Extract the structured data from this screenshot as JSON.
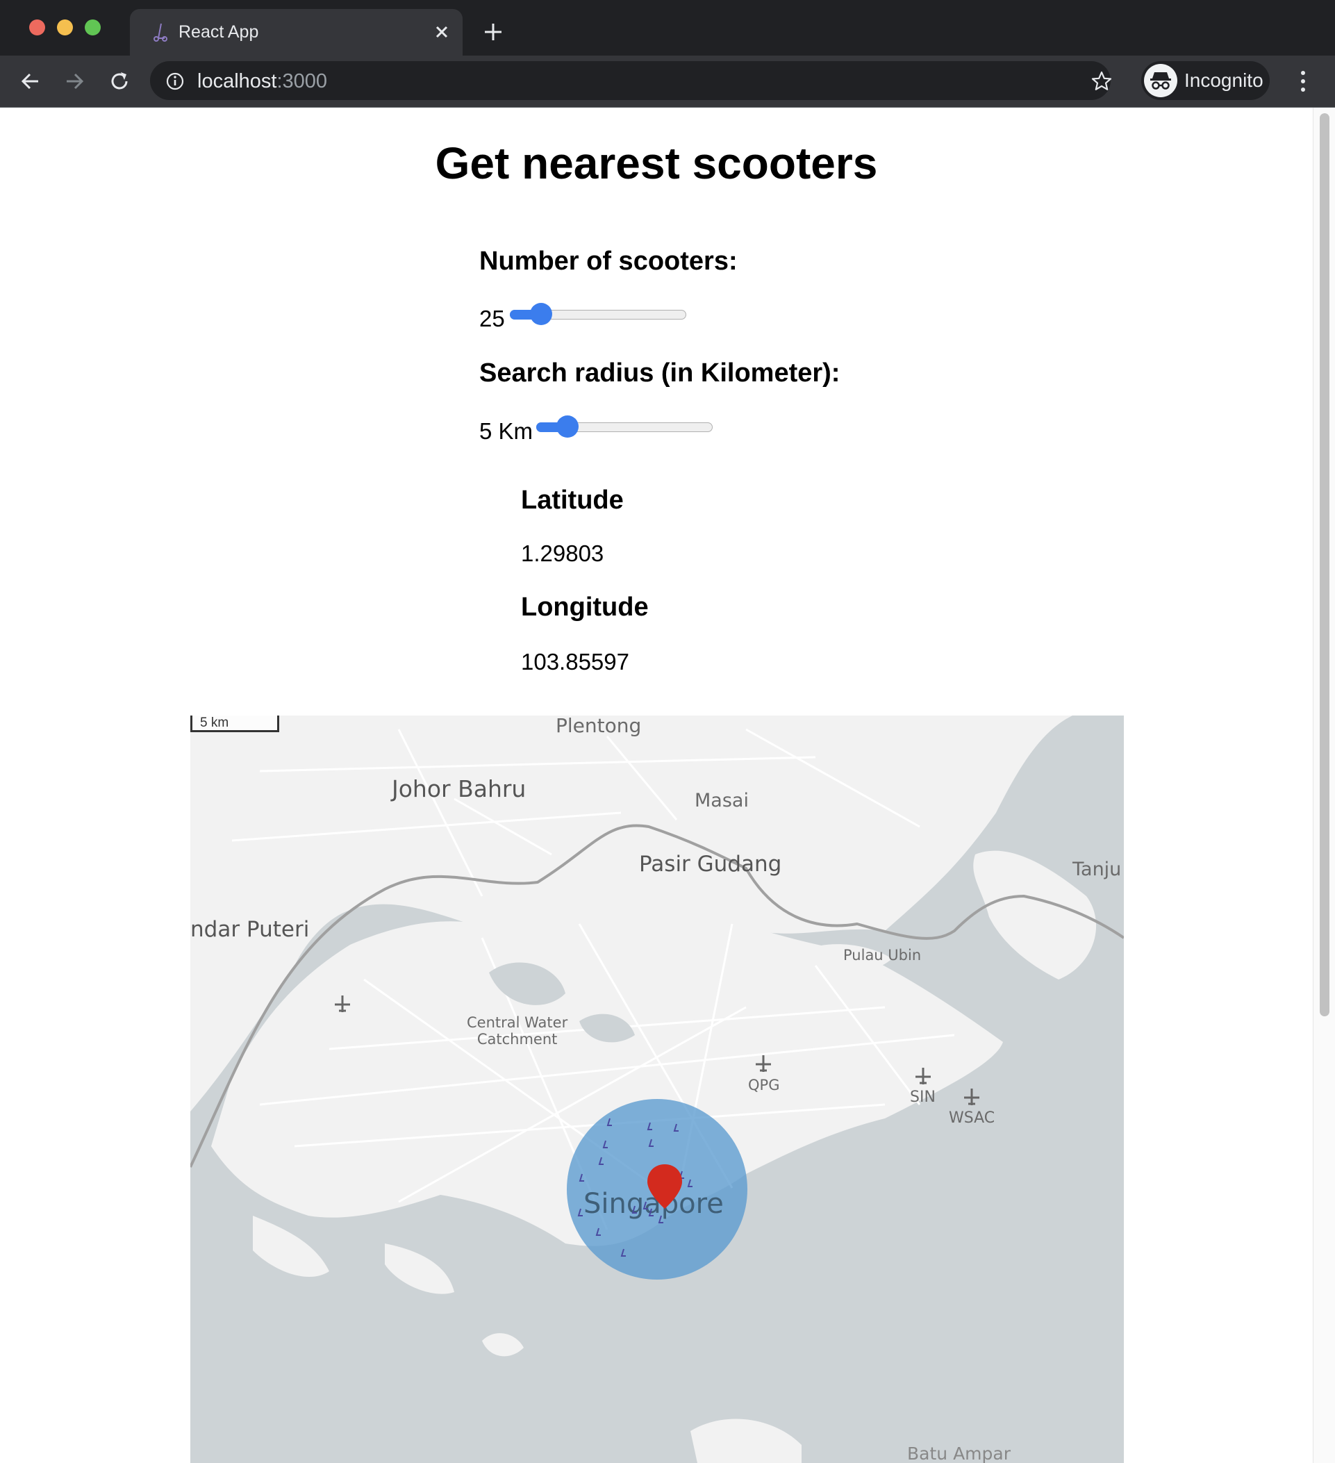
{
  "browser": {
    "tab_title": "React App",
    "url_host": "localhost",
    "url_port": ":3000",
    "profile_label": "Incognito"
  },
  "page": {
    "title": "Get nearest scooters",
    "scooter_count": {
      "label": "Number of scooters:",
      "value": "25",
      "slider_fraction": 0.13
    },
    "radius": {
      "label": "Search radius (in Kilometer):",
      "value": "5 Km",
      "slider_fraction": 0.13
    },
    "latitude": {
      "label": "Latitude",
      "value": "1.29803"
    },
    "longitude": {
      "label": "Longitude",
      "value": "103.85597"
    }
  },
  "map": {
    "scale_label": "5 km",
    "places": {
      "plentong": "Plentong",
      "johor_bahru": "Johor Bahru",
      "masai": "Masai",
      "pasir_gudang": "Pasir Gudang",
      "tanju": "Tanju",
      "bandar_puteri": "ndar Puteri",
      "pulau_ubin": "Pulau Ubin",
      "central_water_1": "Central Water",
      "central_water_2": "Catchment",
      "qpg": "QPG",
      "sin": "SIN",
      "wsac": "WSAC",
      "singapore": "Singapore",
      "batu_ampar": "Batu Ampar"
    },
    "colors": {
      "land": "#f2f2f2",
      "water": "#cdd3d6",
      "radius_circle": "#5b9bcf",
      "marker": "#d32a1e",
      "accent": "#3b7ded"
    }
  }
}
